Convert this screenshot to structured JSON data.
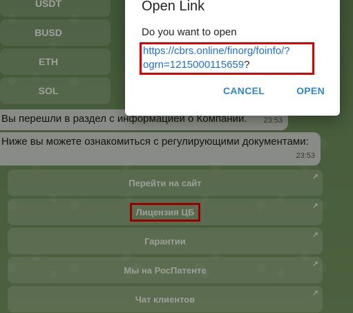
{
  "crypto_buttons": [
    "USDT",
    "BUSD",
    "ETH",
    "SOL"
  ],
  "messages": [
    {
      "text": "Вы перешли в раздел с информацией о Компании.",
      "time": "23:53"
    },
    {
      "text": "Ниже вы можете ознакомиться с регулирующими документами:",
      "time": "23:53"
    }
  ],
  "inline_buttons": [
    "Перейти на сайт",
    "Лицензия ЦБ",
    "Гарантии",
    "Мы на РосПатенте",
    "Чат клиентов"
  ],
  "dialog": {
    "title": "Open Link",
    "prompt": "Do you want to open",
    "url": "https://cbrs.online/finorg/foinfo/?ogrn=1215000115659",
    "url_suffix": "?",
    "cancel": "CANCEL",
    "open": "OPEN"
  },
  "colors": {
    "link": "#1e6fd6",
    "action": "#2f86d3",
    "highlight": "#e00000"
  }
}
